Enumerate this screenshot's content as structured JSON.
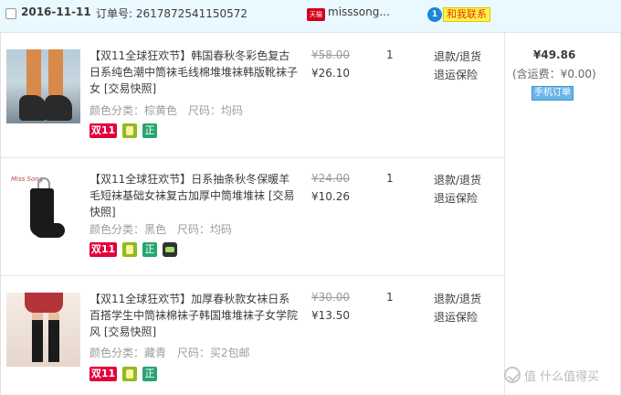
{
  "order": {
    "date": "2016-11-11",
    "order_number_label": "订单号:",
    "order_number": "2617872541150572",
    "shop_badge": "天猫",
    "shop_name": "misssong...",
    "chat_label": "和我联系",
    "chat_icon": "chat-bubble-icon",
    "total": "¥49.86",
    "postage": "(含运费：¥0.00)",
    "mobile_order_label": "手机订单"
  },
  "items": [
    {
      "title": "【双11全球狂欢节】韩国春秋冬彩色复古日系纯色潮中筒袜毛线棉堆堆袜韩版靴袜子女 [交易快照]",
      "attr_color": "颜色分类：棕黄色",
      "attr_size": "尺码：均码",
      "original_price": "¥58.00",
      "price": "¥26.10",
      "quantity": "1",
      "refund": "退款/退货",
      "insurance": "退运保险",
      "tag_11": "双11",
      "tag_zheng": "正"
    },
    {
      "title": "【双11全球狂欢节】日系抽条秋冬保暖羊毛短袜基础女袜复古加厚中筒堆堆袜 [交易快照]",
      "attr_color": "颜色分类：黑色",
      "attr_size": "尺码：均码",
      "original_price": "¥24.00",
      "price": "¥10.26",
      "quantity": "1",
      "refund": "退款/退货",
      "insurance": "退运保险",
      "tag_11": "双11",
      "tag_zheng": "正",
      "image_label": "Miss Song"
    },
    {
      "title": "【双11全球狂欢节】加厚春秋款女袜日系百搭学生中筒袜棉袜子韩国堆堆袜子女学院风 [交易快照]",
      "attr_color": "颜色分类：藏青",
      "attr_size": "尺码：买2包邮",
      "original_price": "¥30.00",
      "price": "¥13.50",
      "quantity": "1",
      "refund": "退款/退货",
      "insurance": "退运保险",
      "tag_11": "双11",
      "tag_zheng": "正"
    }
  ],
  "watermark": {
    "text": "值 什么值得买",
    "icon": "smzdm-logo-icon"
  },
  "colors": {
    "header_bg": "#eaf8ff",
    "tag_11": "#e3003b",
    "chat_bg": "#fff24d"
  }
}
